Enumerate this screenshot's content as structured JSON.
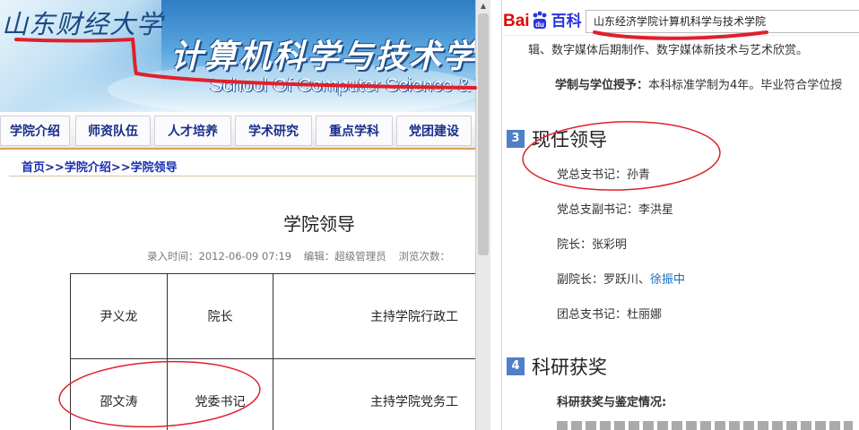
{
  "left": {
    "banner": {
      "school_logo": "山东财经大学",
      "school_name_cn": "计算机科学与技术学",
      "school_name_en": "School Of Computer Science & T"
    },
    "nav": [
      "学院介绍",
      "师资队伍",
      "人才培养",
      "学术研究",
      "重点学科",
      "党团建设"
    ],
    "breadcrumb": [
      "首页",
      "学院介绍",
      "学院领导"
    ],
    "breadcrumb_sep": ">>",
    "article": {
      "title": "学院领导",
      "meta": {
        "entry_time": "录入时间：2012-06-09 07:19",
        "editor": "编辑：超级管理员",
        "views": "浏览次数："
      }
    },
    "table": [
      {
        "name": "尹义龙",
        "position": "院长",
        "duty": "主持学院行政工"
      },
      {
        "name": "邵文涛",
        "position": "党委书记",
        "duty": "主持学院党务工"
      }
    ]
  },
  "right": {
    "baidu": {
      "logo_bai": "Bai",
      "logo_du": "du",
      "logo_baike": "百科",
      "search_value": "山东经济学院计算机科学与技术学院"
    },
    "intro_line": "辑、数字媒体后期制作、数字媒体新技术与艺术欣赏。",
    "degree_label": "学制与学位授予：",
    "degree_text": "本科标准学制为4年。毕业符合学位授",
    "section3": {
      "num": "3",
      "title": "现任领导"
    },
    "leaders": [
      {
        "label": "党总支书记：",
        "name": "孙青"
      },
      {
        "label": "党总支副书记：",
        "name": "李洪星"
      },
      {
        "label": "院长：",
        "name": "张彩明"
      },
      {
        "label": "副院长：",
        "name": "罗跃川、",
        "link": "徐振中"
      },
      {
        "label": "团总支书记：",
        "name": "杜丽娜"
      }
    ],
    "section4": {
      "num": "4",
      "title": "科研获奖"
    },
    "award_sub": "科研获奖与鉴定情况:"
  },
  "colors": {
    "nav_text": "#1a2f8a",
    "link_blue": "#136ec2",
    "annotation_red": "#e0202a",
    "section_badge": "#4f7fc9",
    "baidu_red": "#e10602",
    "baidu_blue": "#2932e1"
  }
}
